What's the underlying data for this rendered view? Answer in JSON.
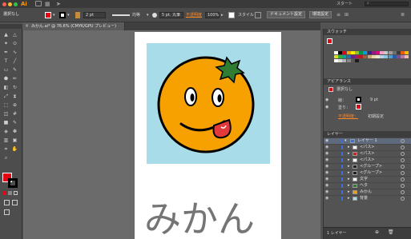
{
  "app": {
    "logo": "Ai",
    "title": "スタート",
    "search_placeholder": ""
  },
  "control_bar": {
    "selection": "選択なし",
    "stroke_value": "2 pt",
    "stroke_style": "均等",
    "brush": "5 pt. 丸筆",
    "opacity_label": "不透明度",
    "opacity_value": "100%",
    "style_label": "スタイル",
    "doc_setup": "ドキュメント設定",
    "preferences": "環境設定"
  },
  "document": {
    "tab_title": "みかん.ai* @ 76.6% (CMYK/GPU プレビュー)"
  },
  "artwork": {
    "handwriting": "みかん"
  },
  "panels": {
    "swatches": {
      "title": "スウォッチ"
    },
    "appearance": {
      "title": "アピアランス",
      "target": "選択なし",
      "stroke_label": "線：",
      "stroke_value": "9 pt",
      "fill_label": "塗り：",
      "opacity_label": "不透明度：",
      "opacity_value": "初期設定"
    },
    "layers": {
      "title": "レイヤー",
      "items": [
        {
          "label": "レイヤー 1",
          "color": "#3a6fd8"
        },
        {
          "label": "<パス>",
          "color": "#ffffff"
        },
        {
          "label": "<パス>",
          "color": "#d22222"
        },
        {
          "label": "<パス>",
          "color": "#ffffff"
        },
        {
          "label": "<グループ>",
          "color": "#222222"
        },
        {
          "label": "<グループ>",
          "color": "#222222"
        },
        {
          "label": "文字",
          "color": "#ffffff"
        },
        {
          "label": "ヘタ",
          "color": "#2e7d32"
        },
        {
          "label": "みかん",
          "color": "#f5a000"
        },
        {
          "label": "背景",
          "color": "#a8dce8"
        }
      ],
      "footer": "1 レイヤー"
    }
  },
  "colors": {
    "fill": "#e30613",
    "stroke": "#000000",
    "accent": "#3a6fd8"
  }
}
